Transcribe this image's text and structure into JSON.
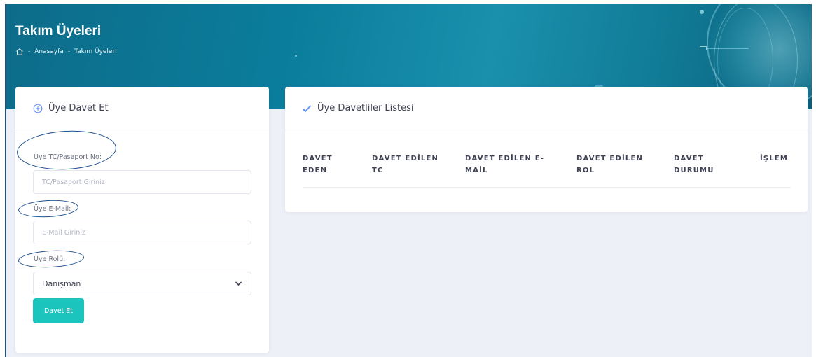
{
  "header": {
    "title": "Takım Üyeleri",
    "breadcrumb": {
      "home_icon": "home-icon",
      "items": [
        "Anasayfa",
        "Takım Üyeleri"
      ],
      "separator": "-"
    }
  },
  "invite_card": {
    "icon": "plus-circle-icon",
    "title": "Üye Davet Et",
    "fields": {
      "tc": {
        "label": "Üye TC/Pasaport No:",
        "placeholder": "TC/Pasaport Giriniz",
        "value": ""
      },
      "email": {
        "label": "Üye E-Mail:",
        "placeholder": "E-Mail Giriniz",
        "value": ""
      },
      "role": {
        "label": "Üye Rolü:",
        "selected": "Danışman"
      }
    },
    "submit_label": "Davet Et"
  },
  "invites_card": {
    "icon": "check-icon",
    "title": "Üye Davetliler Listesi",
    "columns": [
      {
        "line1": "DAVET",
        "line2": "EDEN"
      },
      {
        "line1": "DAVET EDİLEN",
        "line2": "TC"
      },
      {
        "line1": "DAVET EDİLEN E-",
        "line2": "MAİL"
      },
      {
        "line1": "DAVET EDİLEN",
        "line2": "ROL"
      },
      {
        "line1": "DAVET",
        "line2": "DURUMU"
      },
      {
        "line1": "",
        "line2": "İŞLEM"
      }
    ],
    "rows": []
  },
  "colors": {
    "header_bg": "#0b7d9c",
    "accent_button": "#1bc5bd",
    "check_icon": "#6993ff",
    "annotation_ovals": "#1e4f8c",
    "content_bg": "#eef0f8"
  }
}
